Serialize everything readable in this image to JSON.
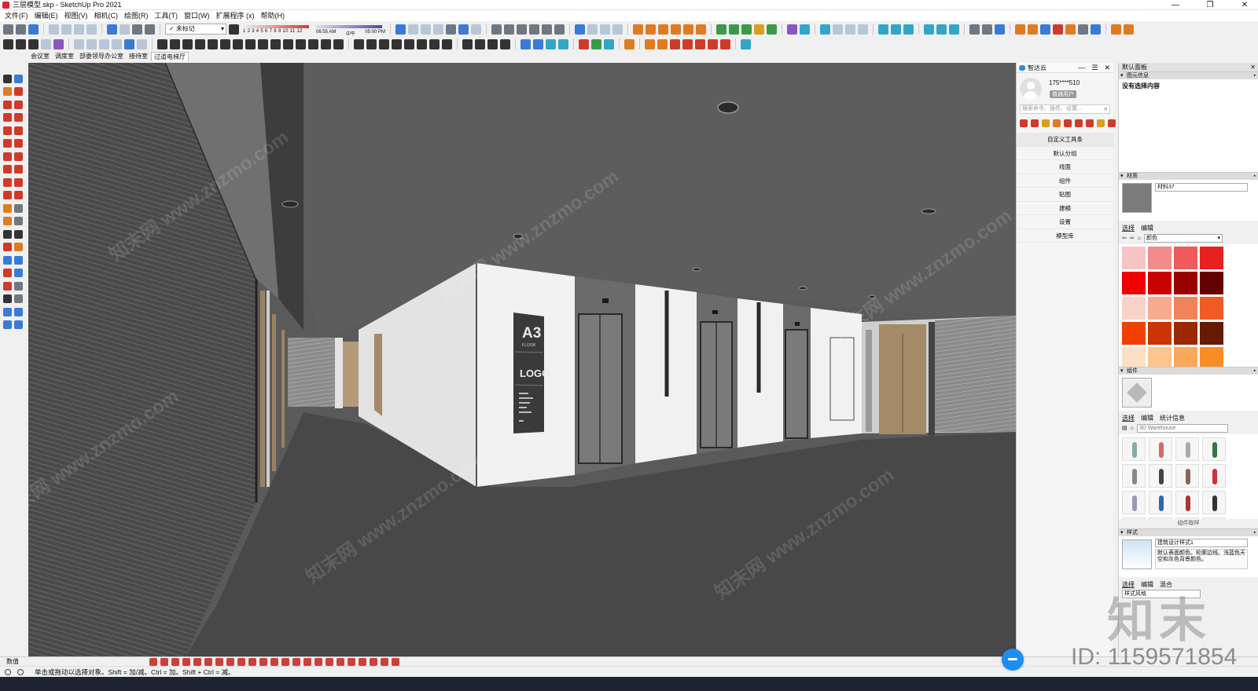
{
  "window": {
    "title": "三层模型.skp - SketchUp Pro 2021",
    "controls": [
      "—",
      "❐",
      "✕"
    ]
  },
  "menu": [
    "文件(F)",
    "编辑(E)",
    "视图(V)",
    "相机(C)",
    "绘图(R)",
    "工具(T)",
    "窗口(W)",
    "扩展程序 (x)",
    "帮助(H)"
  ],
  "toolbar": {
    "tag_select": "✓ 未标记",
    "shadow_months": "1 2 3 4 5 6 7 8 9 10 11 12",
    "shadow_time_start": "06:55 AM",
    "shadow_time_mid": "中午",
    "shadow_time_end": "05:00 PM"
  },
  "scene_tabs": [
    {
      "label": "会议室",
      "active": false
    },
    {
      "label": "调度室",
      "active": false
    },
    {
      "label": "部委领导办公室",
      "active": false
    },
    {
      "label": "接待室",
      "active": false
    },
    {
      "label": "过道电梯厅",
      "active": true
    }
  ],
  "viewport": {
    "wall_sign_top": "A3",
    "wall_sign_sub": "FLOOR",
    "wall_sign_logo": "LOGO",
    "watermark_text": "知末网 www.znzmo.com"
  },
  "zhixiaoyun": {
    "title": "智达云",
    "header_buttons": [
      "—",
      "☰",
      "✕"
    ],
    "username": "175****510",
    "user_badge": "普通用户",
    "search_placeholder": "搜索命令、插件、设置...",
    "menu": [
      "自定义工具条",
      "默认分组",
      "线面",
      "组件",
      "贴图",
      "建模",
      "设置",
      "模型库"
    ]
  },
  "tray": {
    "title": "默认面板",
    "entity_info": {
      "header": "图元信息",
      "content": "没有选择内容"
    },
    "materials": {
      "header": "材质",
      "name": "材料37",
      "tabs": [
        "选择",
        "编辑"
      ],
      "collection": "颜色",
      "swatches": [
        "#f7c4c4",
        "#f28c8c",
        "#ef5a5a",
        "#e92020",
        "#f00000",
        "#c90000",
        "#990000",
        "#650000",
        "#f8d4c8",
        "#f6aa8e",
        "#f2825a",
        "#ef5a25",
        "#f04000",
        "#cc3400",
        "#9a2800",
        "#661a00",
        "#fde0c4",
        "#fcc48e",
        "#faa85a",
        "#f88c25"
      ]
    },
    "components": {
      "header": "组件",
      "tabs": [
        "选择",
        "编辑",
        "统计信息"
      ],
      "search_placeholder": "3D Warehouse",
      "footer": "组件取样",
      "thumb_colors": [
        "#8aa",
        "#d66",
        "#aaa",
        "#374",
        "#888",
        "#444",
        "#865",
        "#c33",
        "#99b",
        "#36a",
        "#a33",
        "#333",
        "#889",
        "#58a",
        "#557",
        "#6a6"
      ]
    },
    "styles": {
      "header": "样式",
      "name": "建筑设计样式1",
      "description": "默认表面颜色。轮廓边线。浅蓝色天空和灰色背景颜色。",
      "tabs": [
        "选择",
        "编辑",
        "混合"
      ],
      "collection": "样式风格"
    }
  },
  "measurements_label": "数值",
  "status_text": "单击或拖动以选择对象。Shift = 加/减。Ctrl = 加。Shift + Ctrl = 减。",
  "id_watermark": "ID: 1159571854",
  "big_watermark": "知末"
}
